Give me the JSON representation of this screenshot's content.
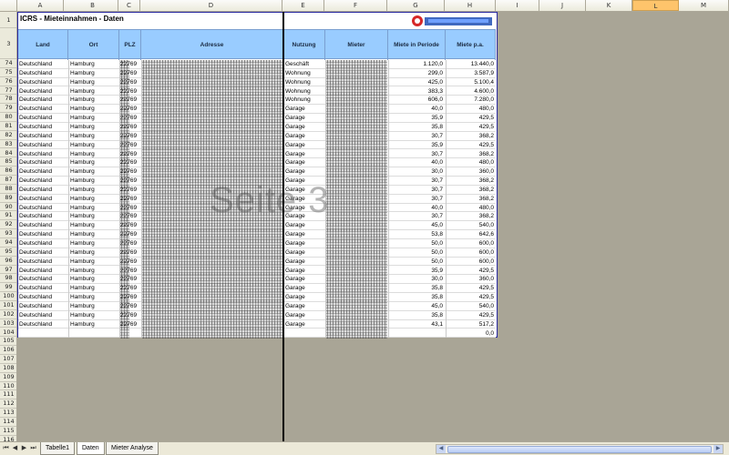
{
  "columns": [
    "A",
    "B",
    "C",
    "D",
    "E",
    "F",
    "G",
    "H",
    "I",
    "J",
    "K",
    "L",
    "M"
  ],
  "selected_column": "L",
  "sheet": {
    "title": "ICRS - Mieteinnahmen - Daten",
    "headers": [
      "Land",
      "Ort",
      "PLZ",
      "Adresse",
      "Nutzung",
      "Mieter",
      "Miete in Periode",
      "Miete p.a."
    ],
    "watermark": "Seite 3",
    "rows": [
      {
        "n": "74",
        "land": "Deutschland",
        "ort": "Hamburg",
        "plz": "22769",
        "nutzung": "Geschäft",
        "mp": "1.120,0",
        "mpa": "13.440,0"
      },
      {
        "n": "75",
        "land": "Deutschland",
        "ort": "Hamburg",
        "plz": "22769",
        "nutzung": "Wohnung",
        "mp": "299,0",
        "mpa": "3.587,9"
      },
      {
        "n": "76",
        "land": "Deutschland",
        "ort": "Hamburg",
        "plz": "22769",
        "nutzung": "Wohnung",
        "mp": "425,0",
        "mpa": "5.100,4"
      },
      {
        "n": "77",
        "land": "Deutschland",
        "ort": "Hamburg",
        "plz": "22769",
        "nutzung": "Wohnung",
        "mp": "383,3",
        "mpa": "4.600,0"
      },
      {
        "n": "78",
        "land": "Deutschland",
        "ort": "Hamburg",
        "plz": "22769",
        "nutzung": "Wohnung",
        "mp": "606,0",
        "mpa": "7.280,0"
      },
      {
        "n": "79",
        "land": "Deutschland",
        "ort": "Hamburg",
        "plz": "22769",
        "nutzung": "Garage",
        "mp": "40,0",
        "mpa": "480,0"
      },
      {
        "n": "80",
        "land": "Deutschland",
        "ort": "Hamburg",
        "plz": "22769",
        "nutzung": "Garage",
        "mp": "35,9",
        "mpa": "429,5"
      },
      {
        "n": "81",
        "land": "Deutschland",
        "ort": "Hamburg",
        "plz": "22769",
        "nutzung": "Garage",
        "mp": "35,8",
        "mpa": "429,5"
      },
      {
        "n": "82",
        "land": "Deutschland",
        "ort": "Hamburg",
        "plz": "22769",
        "nutzung": "Garage",
        "mp": "30,7",
        "mpa": "368,2"
      },
      {
        "n": "83",
        "land": "Deutschland",
        "ort": "Hamburg",
        "plz": "22769",
        "nutzung": "Garage",
        "mp": "35,9",
        "mpa": "429,5"
      },
      {
        "n": "84",
        "land": "Deutschland",
        "ort": "Hamburg",
        "plz": "22769",
        "nutzung": "Garage",
        "mp": "30,7",
        "mpa": "368,2"
      },
      {
        "n": "85",
        "land": "Deutschland",
        "ort": "Hamburg",
        "plz": "22769",
        "nutzung": "Garage",
        "mp": "40,0",
        "mpa": "480,0"
      },
      {
        "n": "86",
        "land": "Deutschland",
        "ort": "Hamburg",
        "plz": "22769",
        "nutzung": "Garage",
        "mp": "30,0",
        "mpa": "360,0"
      },
      {
        "n": "87",
        "land": "Deutschland",
        "ort": "Hamburg",
        "plz": "22769",
        "nutzung": "Garage",
        "mp": "30,7",
        "mpa": "368,2"
      },
      {
        "n": "88",
        "land": "Deutschland",
        "ort": "Hamburg",
        "plz": "22769",
        "nutzung": "Garage",
        "mp": "30,7",
        "mpa": "368,2"
      },
      {
        "n": "89",
        "land": "Deutschland",
        "ort": "Hamburg",
        "plz": "22769",
        "nutzung": "Garage",
        "mp": "30,7",
        "mpa": "368,2"
      },
      {
        "n": "90",
        "land": "Deutschland",
        "ort": "Hamburg",
        "plz": "22769",
        "nutzung": "Garage",
        "mp": "40,0",
        "mpa": "480,0"
      },
      {
        "n": "91",
        "land": "Deutschland",
        "ort": "Hamburg",
        "plz": "22769",
        "nutzung": "Garage",
        "mp": "30,7",
        "mpa": "368,2"
      },
      {
        "n": "92",
        "land": "Deutschland",
        "ort": "Hamburg",
        "plz": "22769",
        "nutzung": "Garage",
        "mp": "45,0",
        "mpa": "540,0"
      },
      {
        "n": "93",
        "land": "Deutschland",
        "ort": "Hamburg",
        "plz": "22769",
        "nutzung": "Garage",
        "mp": "53,8",
        "mpa": "642,6"
      },
      {
        "n": "94",
        "land": "Deutschland",
        "ort": "Hamburg",
        "plz": "22769",
        "nutzung": "Garage",
        "mp": "50,0",
        "mpa": "600,0"
      },
      {
        "n": "95",
        "land": "Deutschland",
        "ort": "Hamburg",
        "plz": "22769",
        "nutzung": "Garage",
        "mp": "50,0",
        "mpa": "600,0"
      },
      {
        "n": "96",
        "land": "Deutschland",
        "ort": "Hamburg",
        "plz": "22769",
        "nutzung": "Garage",
        "mp": "50,0",
        "mpa": "600,0"
      },
      {
        "n": "97",
        "land": "Deutschland",
        "ort": "Hamburg",
        "plz": "22769",
        "nutzung": "Garage",
        "mp": "35,9",
        "mpa": "429,5"
      },
      {
        "n": "98",
        "land": "Deutschland",
        "ort": "Hamburg",
        "plz": "22769",
        "nutzung": "Garage",
        "mp": "30,0",
        "mpa": "360,0"
      },
      {
        "n": "99",
        "land": "Deutschland",
        "ort": "Hamburg",
        "plz": "22769",
        "nutzung": "Garage",
        "mp": "35,8",
        "mpa": "429,5"
      },
      {
        "n": "100",
        "land": "Deutschland",
        "ort": "Hamburg",
        "plz": "22769",
        "nutzung": "Garage",
        "mp": "35,8",
        "mpa": "429,5"
      },
      {
        "n": "101",
        "land": "Deutschland",
        "ort": "Hamburg",
        "plz": "22769",
        "nutzung": "Garage",
        "mp": "45,0",
        "mpa": "540,0"
      },
      {
        "n": "102",
        "land": "Deutschland",
        "ort": "Hamburg",
        "plz": "22769",
        "nutzung": "Garage",
        "mp": "35,8",
        "mpa": "429,5"
      },
      {
        "n": "103",
        "land": "Deutschland",
        "ort": "Hamburg",
        "plz": "22769",
        "nutzung": "Garage",
        "mp": "43,1",
        "mpa": "517,2"
      }
    ],
    "total_row": {
      "n": "104",
      "mpa": "0,0"
    },
    "empty_rows": [
      "105",
      "106",
      "107",
      "108",
      "109",
      "110",
      "111",
      "112",
      "113",
      "114",
      "115",
      "116"
    ],
    "header_row_numbers": [
      "1",
      "3"
    ]
  },
  "tabs": [
    "Tabelle1",
    "Daten",
    "Mieter Analyse"
  ],
  "active_tab": "Daten",
  "nav_icons": [
    "first-sheet-icon",
    "prev-sheet-icon",
    "next-sheet-icon",
    "last-sheet-icon"
  ],
  "colors": {
    "header_band": "#99ccff",
    "print_border": "#2a2aa0",
    "background": "#a9a596",
    "selected_col": "#fec46b"
  }
}
